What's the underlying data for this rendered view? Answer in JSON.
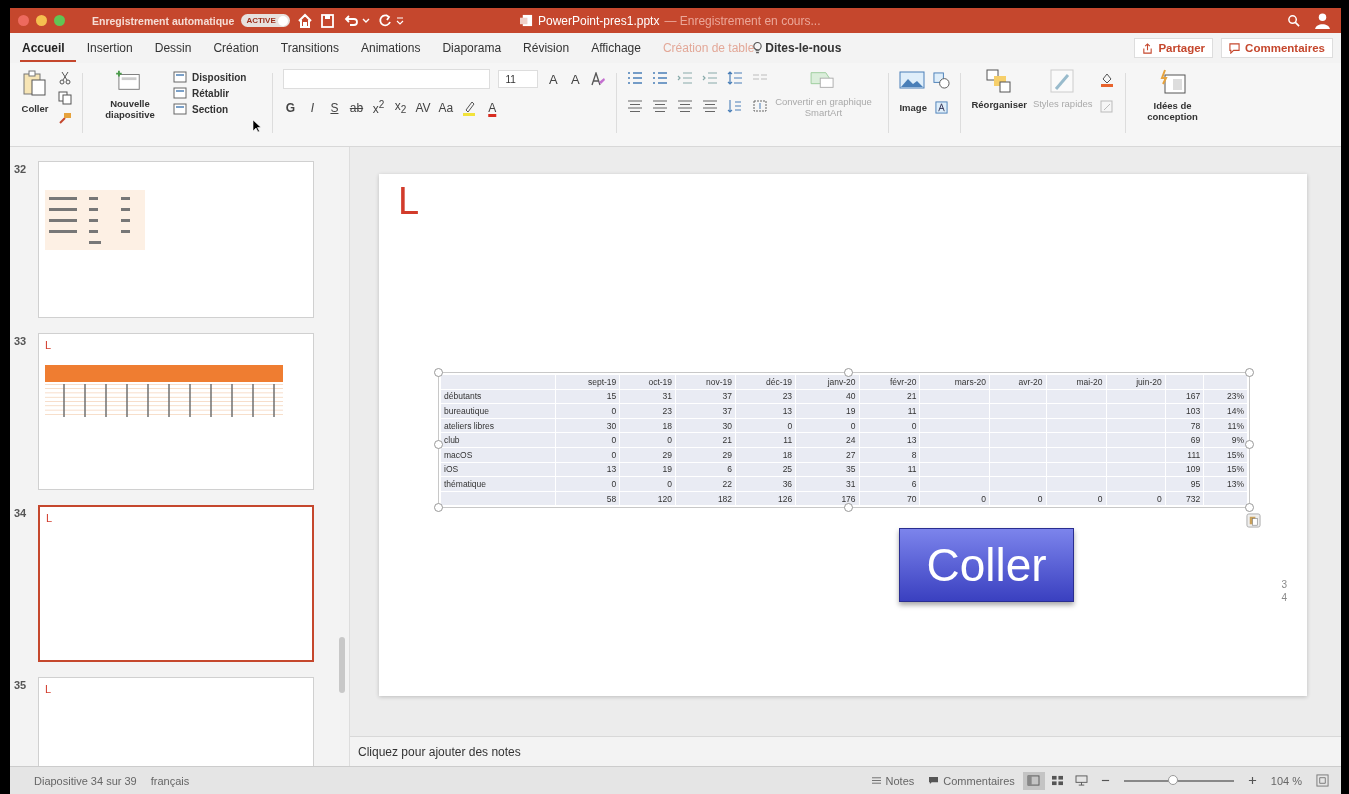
{
  "title_bar": {
    "autosave_label": "Enregistrement automatique",
    "autosave": {
      "label": "ACTIVE",
      "on": true
    },
    "document": "PowerPoint-pres1.pptx",
    "status": "— Enregistrement en cours..."
  },
  "tabs": [
    {
      "label": "Accueil",
      "selected": true,
      "disabled": false
    },
    {
      "label": "Insertion",
      "selected": false,
      "disabled": false
    },
    {
      "label": "Dessin",
      "selected": false,
      "disabled": false
    },
    {
      "label": "Création",
      "selected": false,
      "disabled": false
    },
    {
      "label": "Transitions",
      "selected": false,
      "disabled": false
    },
    {
      "label": "Animations",
      "selected": false,
      "disabled": false
    },
    {
      "label": "Diaporama",
      "selected": false,
      "disabled": false
    },
    {
      "label": "Révision",
      "selected": false,
      "disabled": false
    },
    {
      "label": "Affichage",
      "selected": false,
      "disabled": false
    },
    {
      "label": "Création de table",
      "selected": false,
      "disabled": true
    }
  ],
  "tell_me": "Dites-le-nous",
  "share_button": "Partager",
  "comments_button": "Commentaires",
  "ribbon": {
    "paste": "Coller",
    "new_slide": "Nouvelle diapositive",
    "slide_commands": [
      "Disposition",
      "Rétablir",
      "Section"
    ],
    "font_size": "11",
    "size_buttons": [
      "A",
      "A"
    ],
    "format_buttons": [
      {
        "kind": "bold",
        "label": "G"
      },
      {
        "kind": "italic",
        "label": "I"
      },
      {
        "kind": "underline",
        "label": "S"
      },
      {
        "kind": "strike",
        "label": "ab"
      },
      {
        "kind": "superscript",
        "label": "x$^{2}$"
      },
      {
        "kind": "subscript",
        "label": "x$_{2}$"
      },
      {
        "kind": "spacing",
        "label": "AV"
      },
      {
        "kind": "case",
        "label": "Aa"
      }
    ],
    "font_color": "A",
    "smartart": {
      "label": "Convertir en graphique SmartArt",
      "disabled": true
    },
    "image": "Image",
    "arrange": "Réorganiser",
    "quick_styles": {
      "label": "Styles rapides",
      "disabled": true
    },
    "designer": "Idées de conception"
  },
  "thumbnails": [
    {
      "number": "32",
      "kind": "data-table",
      "selected": false
    },
    {
      "number": "33",
      "title": "L",
      "kind": "banded-table",
      "selected": false
    },
    {
      "number": "34",
      "title": "L",
      "kind": "blank",
      "selected": true
    },
    {
      "number": "35",
      "title": "L",
      "kind": "blank",
      "selected": false
    }
  ],
  "slide": {
    "title": "L",
    "table": {
      "columns": [
        "sept-19",
        "oct-19",
        "nov-19",
        "déc-19",
        "janv-20",
        "févr-20",
        "mars-20",
        "avr-20",
        "mai-20",
        "juin-20"
      ],
      "rows": [
        {
          "label": "débutants",
          "values": [
            "15",
            "31",
            "37",
            "23",
            "40",
            "21"
          ],
          "total": "167",
          "share": "23%"
        },
        {
          "label": "bureautique",
          "values": [
            "0",
            "23",
            "37",
            "13",
            "19",
            "11"
          ],
          "total": "103",
          "share": "14%"
        },
        {
          "label": "ateliers libres",
          "values": [
            "30",
            "18",
            "30",
            "0",
            "0",
            "0"
          ],
          "total": "78",
          "share": "11%"
        },
        {
          "label": "club",
          "values": [
            "0",
            "0",
            "21",
            "11",
            "24",
            "13"
          ],
          "total": "69",
          "share": "9%"
        },
        {
          "label": "macOS",
          "values": [
            "0",
            "29",
            "29",
            "18",
            "27",
            "8"
          ],
          "total": "111",
          "share": "15%"
        },
        {
          "label": "iOS",
          "values": [
            "13",
            "19",
            "6",
            "25",
            "35",
            "11"
          ],
          "total": "109",
          "share": "15%"
        },
        {
          "label": "thématique",
          "values": [
            "0",
            "0",
            "22",
            "36",
            "31",
            "6"
          ],
          "total": "95",
          "share": "13%"
        },
        {
          "values": [
            "58",
            "120",
            "182",
            "126",
            "176",
            "70",
            "0",
            "0",
            "0",
            "0"
          ],
          "total": "732"
        }
      ]
    },
    "paste_button": "Coller",
    "page_number": "34"
  },
  "notes_placeholder": "Cliquez pour ajouter des notes",
  "status_bar": {
    "slide_position": "Diapositive 34 sur 39",
    "language": "français",
    "notes": "Notes",
    "comments": "Commentaires",
    "views": [
      {
        "kind": "normal",
        "selected": true
      },
      {
        "kind": "sorter",
        "selected": false
      },
      {
        "kind": "reading",
        "selected": false
      }
    ],
    "zoom": {
      "level": 0.45
    },
    "zoom_label": "104 %"
  }
}
